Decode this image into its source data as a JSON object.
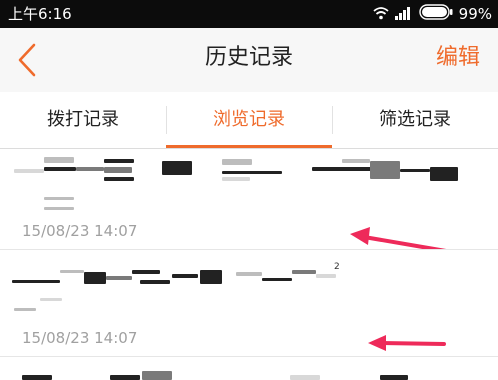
{
  "status_bar": {
    "time": "上午6:16",
    "battery_percent": "99%",
    "icons": [
      "wifi-icon",
      "signal-icon",
      "battery-icon"
    ]
  },
  "header": {
    "title": "历史记录",
    "edit_label": "编辑",
    "back_icon": "chevron-left-icon"
  },
  "tabs": [
    {
      "label": "拨打记录",
      "active": false
    },
    {
      "label": "浏览记录",
      "active": true
    },
    {
      "label": "筛选记录",
      "active": false
    }
  ],
  "records": [
    {
      "time": "15/08/23 14:07"
    },
    {
      "time": "15/08/23 14:07",
      "superscript": "2"
    }
  ],
  "colors": {
    "accent": "#ef6b2c",
    "status_bar_bg": "#0c0c0c",
    "title_bar_bg": "#f7f7f7",
    "arrow": "#ee2a5a"
  }
}
